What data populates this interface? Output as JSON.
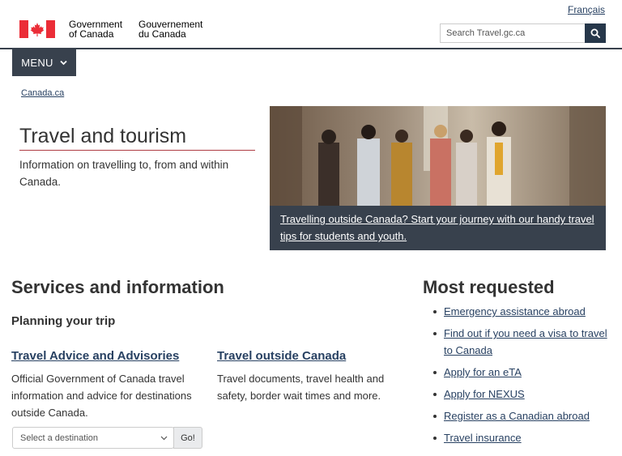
{
  "header": {
    "language_link": "Français",
    "signature_en": [
      "Government",
      "of Canada"
    ],
    "signature_fr": [
      "Gouvernement",
      "du Canada"
    ],
    "search_placeholder": "Search Travel.gc.ca",
    "menu_label": "MENU"
  },
  "breadcrumb": {
    "home": "Canada.ca"
  },
  "page": {
    "title": "Travel and tourism",
    "intro": "Information on travelling to, from and within Canada."
  },
  "hero": {
    "caption": "Travelling outside Canada? Start your journey with our handy travel tips for students and youth."
  },
  "services": {
    "heading": "Services and information",
    "subheading": "Planning your trip",
    "cards": [
      {
        "title": "Travel Advice and Advisories",
        "description": "Official Government of Canada travel information and advice for destinations outside Canada."
      },
      {
        "title": "Travel outside Canada",
        "description": "Travel documents, travel health and safety, border wait times and more."
      }
    ],
    "destination_select": "Select a destination",
    "go_button": "Go!"
  },
  "most_requested": {
    "heading": "Most requested",
    "items": [
      "Emergency assistance abroad",
      "Find out if you need a visa to travel to Canada",
      "Apply for an eTA",
      "Apply for NEXUS",
      "Register as a Canadian abroad",
      "Travel insurance"
    ]
  },
  "colors": {
    "flag_red": "#eb2d37",
    "nav_dark": "#38414d",
    "search_button": "#26374a",
    "link": "#284162",
    "title_rule": "#af3c43"
  },
  "icons": {
    "search": "search-icon",
    "menu_chevron": "chevron-down-icon",
    "select_chevron": "chevron-down-icon",
    "flag": "canada-flag-icon"
  }
}
